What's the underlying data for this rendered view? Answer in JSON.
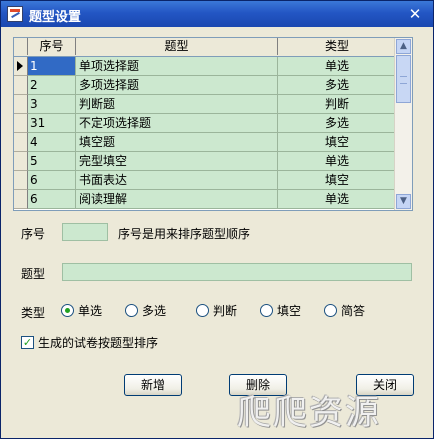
{
  "window": {
    "title": "题型设置",
    "close_glyph": "✕"
  },
  "grid": {
    "columns": [
      "序号",
      "题型",
      "类型"
    ],
    "rows": [
      {
        "seq": "1",
        "name": "单项选择题",
        "type": "单选"
      },
      {
        "seq": "2",
        "name": "多项选择题",
        "type": "多选"
      },
      {
        "seq": "3",
        "name": "判断题",
        "type": "判断"
      },
      {
        "seq": "31",
        "name": "不定项选择题",
        "type": "多选"
      },
      {
        "seq": "4",
        "name": "填空题",
        "type": "填空"
      },
      {
        "seq": "5",
        "name": "完型填空",
        "type": "单选"
      },
      {
        "seq": "6",
        "name": "书面表达",
        "type": "填空"
      },
      {
        "seq": "6",
        "name": "阅读理解",
        "type": "单选"
      }
    ],
    "selected_row": 0,
    "scroll_up_glyph": "▲",
    "scroll_down_glyph": "▼"
  },
  "form": {
    "seq_label": "序号",
    "seq_value": "",
    "seq_hint": "序号是用来排序题型顺序",
    "name_label": "题型",
    "name_value": "",
    "type_label": "类型",
    "type_options": [
      "单选",
      "多选",
      "判断",
      "填空",
      "简答"
    ],
    "type_selected": "单选",
    "sort_checkbox_label": "生成的试卷按题型排序",
    "sort_checkbox_checked": true,
    "check_glyph": "✓"
  },
  "buttons": {
    "add": "新增",
    "delete": "删除",
    "close": "关闭"
  },
  "watermark": "爬爬资源",
  "colors": {
    "grid_cell": "#cce8cf",
    "selection": "#316ac5",
    "titlebar": "#2356c4"
  }
}
